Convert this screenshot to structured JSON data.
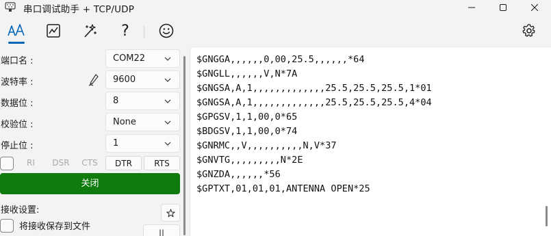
{
  "window": {
    "title": "串口调试助手 + TCP/UDP",
    "icons": [
      "serial-port-app-icon",
      "minimize-icon",
      "maximize-icon",
      "close-icon"
    ]
  },
  "toolbar": {
    "icons": [
      "font-icon",
      "chart-icon",
      "magic-wand-icon",
      "help-icon",
      "smiley-icon",
      "gear-icon"
    ],
    "help_glyph": "?",
    "active_color": "#0064b8"
  },
  "serial_settings": {
    "port": {
      "label": "端口名 :",
      "value": "COM22"
    },
    "baud": {
      "label": "波特率 :",
      "value": "9600"
    },
    "data_bits": {
      "label": "数据位 :",
      "value": "8"
    },
    "parity": {
      "label": "校验位 :",
      "value": "None"
    },
    "stop_bits": {
      "label": "停止位 :",
      "value": "1"
    }
  },
  "signals": {
    "ri": "RI",
    "dsr": "DSR",
    "cts": "CTS",
    "dtr": "DTR",
    "rts": "RTS"
  },
  "close_button": {
    "label": "关闭",
    "color": "#0f7b0f"
  },
  "receive": {
    "settings_label": "接收设置:",
    "save_to_file_label": "将接收保存到文件",
    "pause_label": "||"
  },
  "terminal": {
    "lines": [
      "$GNGGA,,,,,,0,00,25.5,,,,,,*64",
      "$GNGLL,,,,,,V,N*7A",
      "$GNGSA,A,1,,,,,,,,,,,,,25.5,25.5,25.5,1*01",
      "$GNGSA,A,1,,,,,,,,,,,,,25.5,25.5,25.5,4*04",
      "$GPGSV,1,1,00,0*65",
      "$BDGSV,1,1,00,0*74",
      "$GNRMC,,V,,,,,,,,,,N,V*37",
      "$GNVTG,,,,,,,,,N*2E",
      "$GNZDA,,,,,,*56",
      "$GPTXT,01,01,01,ANTENNA OPEN*25"
    ]
  }
}
